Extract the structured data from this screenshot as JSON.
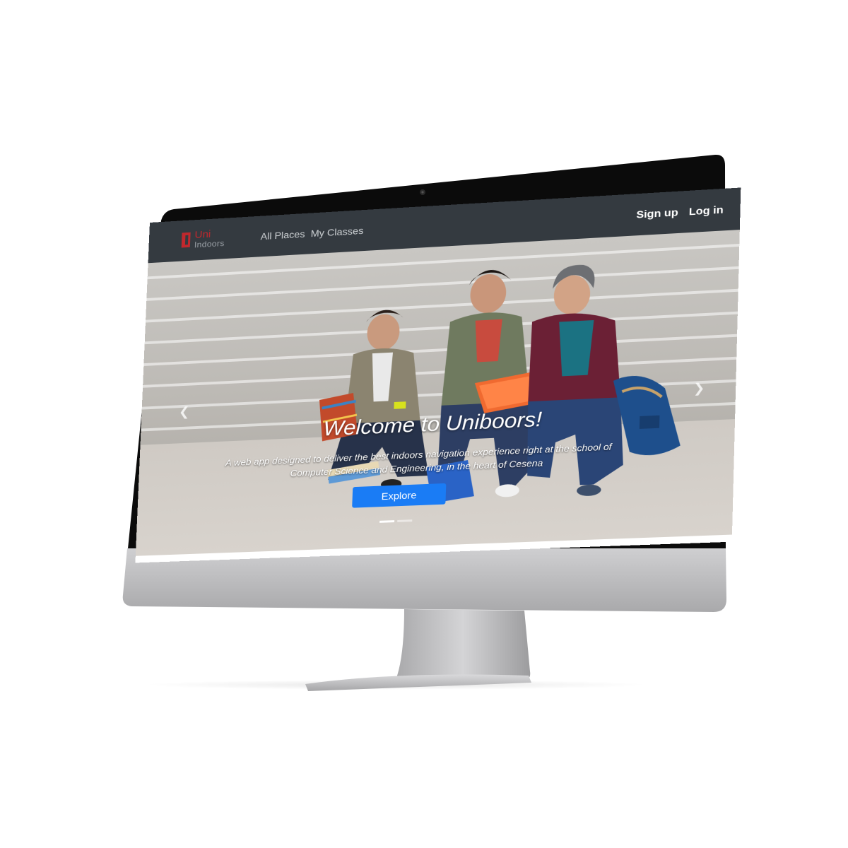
{
  "app": {
    "brand": {
      "line1": "Uni",
      "line2": "Indoors"
    },
    "nav": [
      {
        "label": "All Places"
      },
      {
        "label": "My Classes"
      }
    ],
    "auth": {
      "signup": "Sign up",
      "login": "Log in"
    }
  },
  "hero": {
    "title": "Welcome to Uniboors!",
    "subtitle": "A web app designed to deliver the best indoors navigation experience right at the school of Computer Science and Engineering, in the heart of Cesena",
    "cta": "Explore",
    "prev_icon": "chevron-left-icon",
    "next_icon": "chevron-right-icon",
    "slides": 2,
    "active_slide": 1
  },
  "colors": {
    "navbar": "#343a40",
    "brand_red": "#c0282d",
    "button": "#1a7cf5",
    "bezel": "#0b0b0b",
    "chin": "#bdbdbf"
  }
}
